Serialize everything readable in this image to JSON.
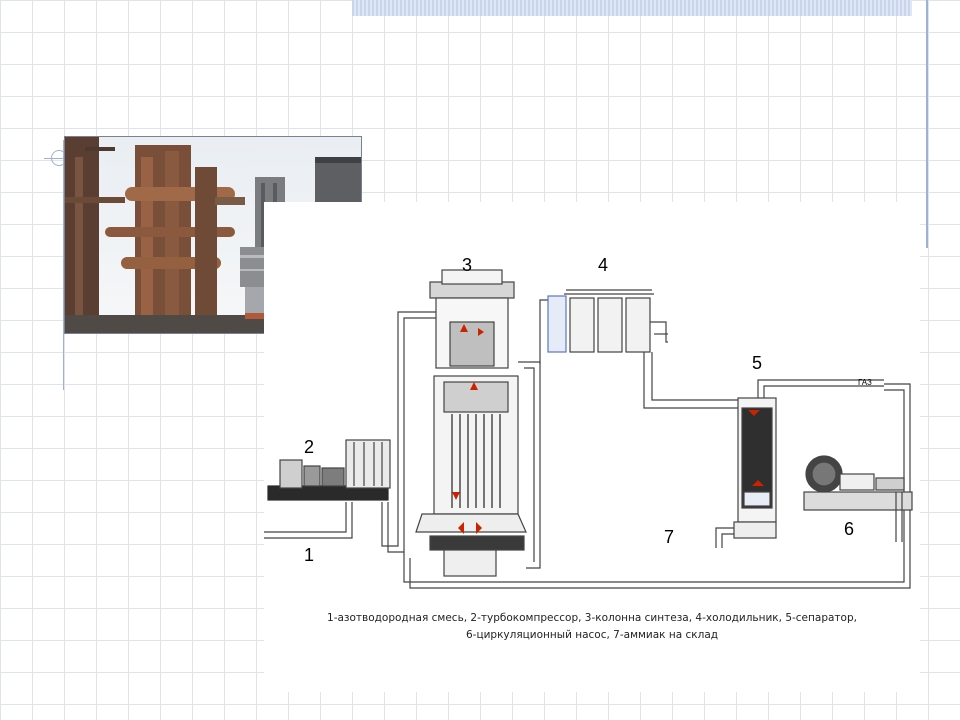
{
  "photo": {
    "icon": "industrial-plant-photo"
  },
  "diagram": {
    "numbers": [
      "1",
      "2",
      "3",
      "4",
      "5",
      "6",
      "7"
    ],
    "gas_label": "ГАЗ",
    "caption_line1": "1-азотводородная смесь, 2-турбокомпрессор, 3-колонна синтеза, 4-холодильник, 5-сепаратор,",
    "caption_line2": "6-циркуляционный насос, 7-аммиак на склад"
  },
  "colors": {
    "grid": "#dde4f0",
    "pipe": "#555555",
    "flow_arrow": "#cc2200",
    "accent_blue": "#5b74c8"
  }
}
